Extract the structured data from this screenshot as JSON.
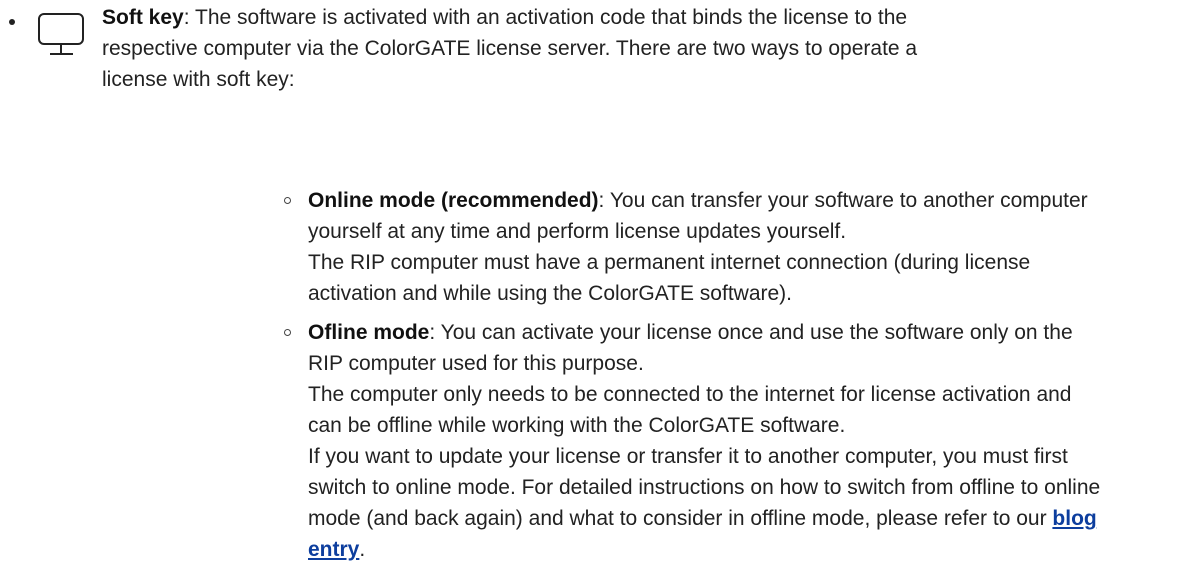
{
  "soft_key": {
    "title": "Soft key",
    "text_line1": ": The software is activated with an activation code that binds the license to the",
    "text_line2": "respective computer via the ColorGATE license server. There are two ways to operate a",
    "text_line3": "license with soft key:"
  },
  "online_mode": {
    "title": "Online mode (recommended)",
    "text_a": ": You can transfer your software to another computer",
    "text_b": "yourself at any time and perform license updates yourself.",
    "text_c": "The RIP computer must have a permanent internet connection (during license",
    "text_d": "activation and while using the ColorGATE software)."
  },
  "offline_mode": {
    "title": "Ofline mode",
    "text_a": ": You can activate your license once and use the software only on the",
    "text_b": "RIP computer used for this purpose.",
    "text_c": "The computer only needs to be connected to the internet for license activation and",
    "text_d": "can be offline while working with the ColorGATE software.",
    "text_e": "If you want to update your license or transfer it to another computer, you must first",
    "text_f": "switch to online mode. For detailed instructions on how to switch from offline to online",
    "text_g": "mode (and back again) and what to consider in offline mode, please refer to our ",
    "link_part1": "blog",
    "link_part2": "entry",
    "end": "."
  },
  "icons": {
    "monitor": "monitor-icon"
  },
  "colors": {
    "link": "#0d3e9e"
  }
}
